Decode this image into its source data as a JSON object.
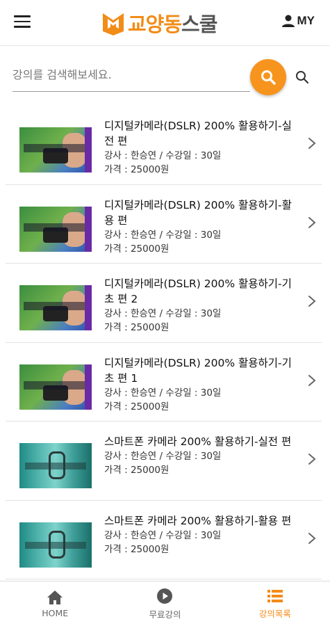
{
  "header": {
    "logo": {
      "part1": "교양동",
      "part2": "스쿨"
    },
    "my_label": "MY"
  },
  "search": {
    "placeholder": "강의를 검색해보세요."
  },
  "courses": [
    {
      "title": "디지털카메라(DSLR) 200% 활용하기-실전 편",
      "instructor": "강사 : 한승연 / 수강일 :  30일",
      "price": "가격 : 25000원",
      "thumb": "dslr"
    },
    {
      "title": "디지털카메라(DSLR) 200% 활용하기-활용 편",
      "instructor": "강사 : 한승연 / 수강일 :  30일",
      "price": "가격 : 25000원",
      "thumb": "dslr"
    },
    {
      "title": "디지털카메라(DSLR) 200% 활용하기-기초 편 2",
      "instructor": "강사 : 한승연 / 수강일 :  30일",
      "price": "가격 : 25000원",
      "thumb": "dslr"
    },
    {
      "title": "디지털카메라(DSLR) 200% 활용하기-기초 편 1",
      "instructor": "강사 : 한승연 / 수강일 :  30일",
      "price": "가격 : 25000원",
      "thumb": "dslr"
    },
    {
      "title": "스마트폰 카메라 200% 활용하기-실전 편",
      "instructor": "강사 : 한승연 / 수강일 :  30일",
      "price": "가격 : 25000원",
      "thumb": "phone"
    },
    {
      "title": "스마트폰 카메라 200% 활용하기-활용 편",
      "instructor": "강사 : 한승연 / 수강일 :  30일",
      "price": "가격 : 25000원",
      "thumb": "phone"
    }
  ],
  "nav": {
    "home": "HOME",
    "free": "무료강의",
    "list": "강의목록"
  },
  "colors": {
    "accent": "#f7941d",
    "active_nav": "#f28c18",
    "text": "#222222"
  },
  "icons": [
    "menu-icon",
    "logo-icon",
    "user-icon",
    "search-icon",
    "chevron-right-icon",
    "home-icon",
    "play-circle-icon",
    "list-icon"
  ]
}
